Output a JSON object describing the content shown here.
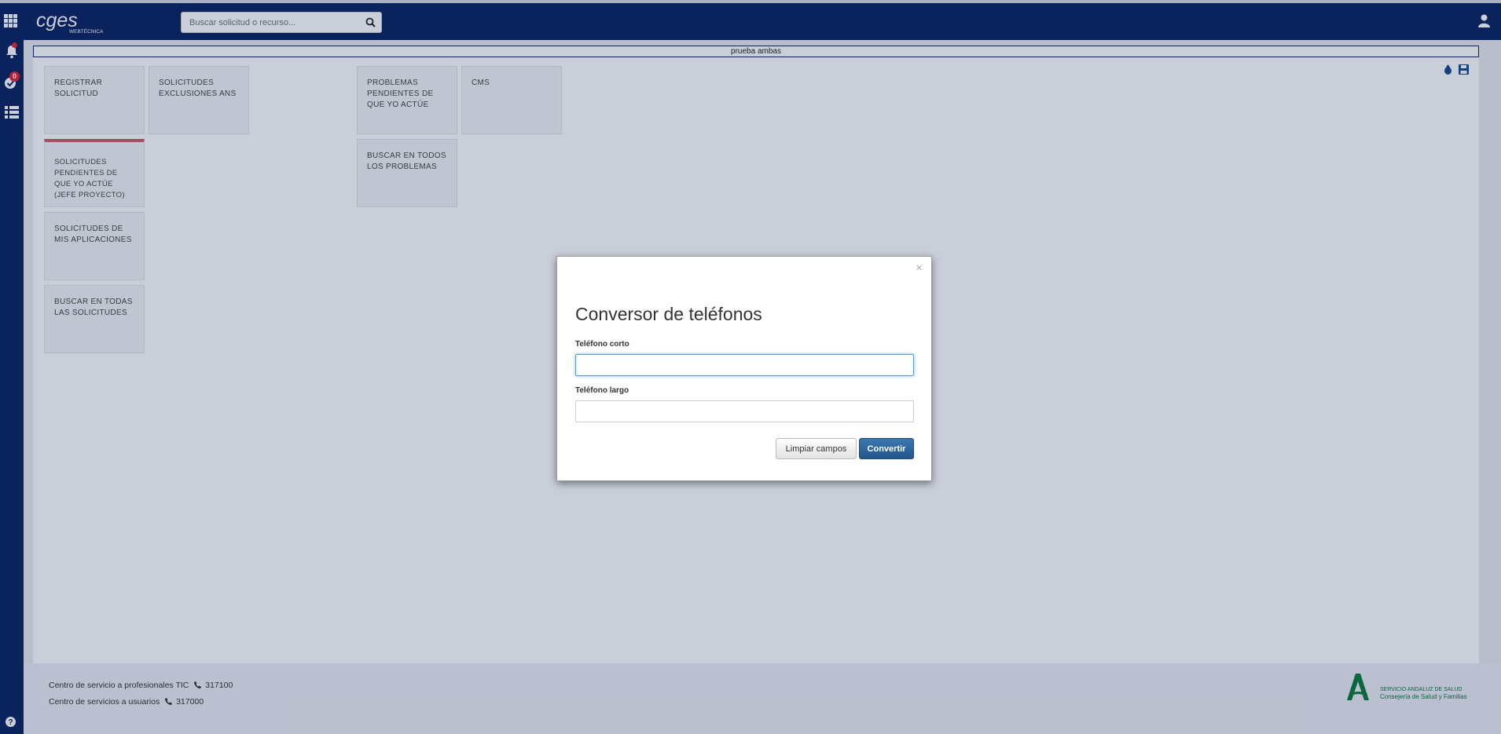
{
  "header": {
    "logo_text": "cges",
    "logo_subtext": "WEBTÉCNICA",
    "search_placeholder": "Buscar solicitud o recurso..."
  },
  "sidebar": {
    "notifications_count": "0"
  },
  "main": {
    "subtitle": "prueba ambas",
    "tiles": [
      {
        "label": "REGISTRAR SOLICITUD"
      },
      {
        "label": "SOLICITUDES EXCLUSIONES ANS"
      },
      {
        "label": "PROBLEMAS PENDIENTES DE QUE YO ACTÚE"
      },
      {
        "label": "CMS"
      },
      {
        "label": "SOLICITUDES PENDIENTES DE QUE YO ACTÚE (JEFE PROYECTO)"
      },
      {
        "label": "BUSCAR EN TODOS LOS PROBLEMAS"
      },
      {
        "label": "SOLICITUDES DE MIS APLICACIONES"
      },
      {
        "label": "BUSCAR EN TODAS LAS SOLICITUDES"
      }
    ]
  },
  "footer": {
    "line1_text": "Centro de servicio a profesionales TIC",
    "line1_phone": "317100",
    "line2_text": "Centro de servicios a usuarios",
    "line2_phone": "317000",
    "logo_line1": "SERVICIO ANDALUZ DE SALUD",
    "logo_line2": "Consejería de Salud y Familias"
  },
  "modal": {
    "close_glyph": "×",
    "title": "Conversor de teléfonos",
    "short_label": "Teléfono corto",
    "short_value": "",
    "long_label": "Teléfono largo",
    "long_value": "",
    "clear_button": "Limpiar campos",
    "convert_button": "Convertir"
  },
  "colors": {
    "nav_bg": "#0b2461",
    "alert_red": "#e8242e",
    "tile_alert_border": "#d25a63",
    "primary_button": "#22568d"
  }
}
